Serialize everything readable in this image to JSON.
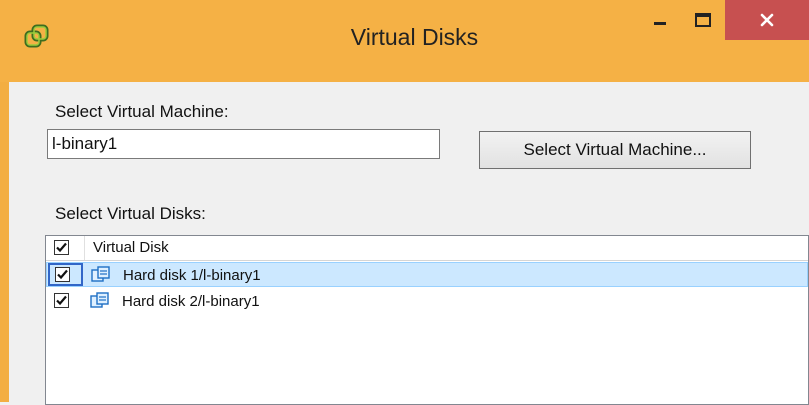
{
  "window": {
    "title": "Virtual Disks",
    "app_icon": "vsphere-logo-icon",
    "accent_color": "#f5b145",
    "close_color": "#c75050"
  },
  "vm_section": {
    "label": "Select Virtual Machine:",
    "input_value": "l-binary1",
    "button_label": "Select Virtual Machine..."
  },
  "disks_section": {
    "label": "Select Virtual Disks:",
    "column_header": "Virtual Disk",
    "header_checked": true,
    "rows": [
      {
        "label": "Hard disk 1/l-binary1",
        "checked": true,
        "selected": true,
        "icon": "virtual-disk-icon"
      },
      {
        "label": "Hard disk 2/l-binary1",
        "checked": true,
        "selected": false,
        "icon": "virtual-disk-icon"
      }
    ]
  }
}
